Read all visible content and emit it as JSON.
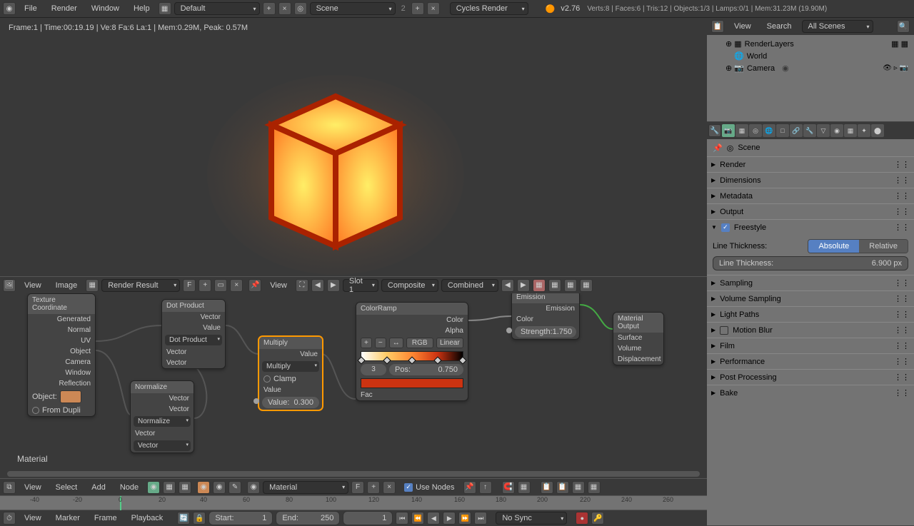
{
  "top_menu": {
    "file": "File",
    "render": "Render",
    "window": "Window",
    "help": "Help"
  },
  "top": {
    "layout": "Default",
    "scene": "Scene",
    "scene_count": "2",
    "engine": "Cycles Render",
    "version": "v2.76",
    "stats": "Verts:8 | Faces:6 | Tris:12 | Objects:1/3 | Lamps:0/1 | Mem:31.23M (19.90M)",
    "obj": "Cube"
  },
  "status": "Frame:1 | Time:00:19.19 | Ve:8 Fa:6 La:1 | Mem:0.29M, Peak: 0.57M",
  "img_header": {
    "view": "View",
    "image": "Image",
    "result": "Render Result",
    "f": "F",
    "view2": "View",
    "slot": "Slot 1",
    "composite": "Composite",
    "combined": "Combined"
  },
  "nodes": {
    "texcoord": {
      "title": "Texture Coordinate",
      "outs": [
        "Generated",
        "Normal",
        "UV",
        "Object",
        "Camera",
        "Window",
        "Reflection"
      ],
      "obj": "Object:",
      "dupli": "From Dupli"
    },
    "normalize": {
      "title": "Normalize",
      "out": "Vector",
      "in": "Vector",
      "op": "Normalize",
      "vec": "Vector"
    },
    "dot": {
      "title": "Dot Product",
      "outs": [
        "Vector",
        "Value"
      ],
      "op": "Dot Product",
      "ins": [
        "Vector",
        "Vector"
      ]
    },
    "mult": {
      "title": "Multiply",
      "out": "Value",
      "op": "Multiply",
      "clamp": "Clamp",
      "in": "Value",
      "val_label": "Value:",
      "val": "0.300"
    },
    "ramp": {
      "title": "ColorRamp",
      "outs": [
        "Color",
        "Alpha"
      ],
      "mode": "RGB",
      "interp": "Linear",
      "idx": "3",
      "pos_label": "Pos:",
      "pos": "0.750",
      "in": "Fac"
    },
    "emit": {
      "title": "Emission",
      "out": "Emission",
      "color": "Color",
      "str_label": "Strength:",
      "str": "1.750"
    },
    "output": {
      "title": "Material Output",
      "ins": [
        "Surface",
        "Volume",
        "Displacement"
      ]
    }
  },
  "material_label": "Material",
  "node_header": {
    "view": "View",
    "select": "Select",
    "add": "Add",
    "node": "Node",
    "material": "Material",
    "f": "F",
    "use_nodes": "Use Nodes"
  },
  "timeline": {
    "ticks": [
      "-40",
      "-20",
      "0",
      "20",
      "40",
      "60",
      "80",
      "100",
      "120",
      "140",
      "160",
      "180",
      "200",
      "220",
      "240",
      "260"
    ],
    "view": "View",
    "marker": "Marker",
    "frame": "Frame",
    "playback": "Playback",
    "start_label": "Start:",
    "start": "1",
    "end_label": "End:",
    "end": "250",
    "current": "1",
    "sync": "No Sync"
  },
  "outliner": {
    "view": "View",
    "search": "Search",
    "scenes": "All Scenes",
    "items": [
      "RenderLayers",
      "World",
      "Camera"
    ]
  },
  "props": {
    "scene": "Scene",
    "sections": [
      "Render",
      "Dimensions",
      "Metadata",
      "Output",
      "Freestyle",
      "Sampling",
      "Volume Sampling",
      "Light Paths",
      "Motion Blur",
      "Film",
      "Performance",
      "Post Processing",
      "Bake"
    ],
    "freestyle": {
      "thick_label": "Line Thickness:",
      "absolute": "Absolute",
      "relative": "Relative",
      "thick_num_label": "Line Thickness:",
      "thick_val": "6.900 px"
    }
  }
}
